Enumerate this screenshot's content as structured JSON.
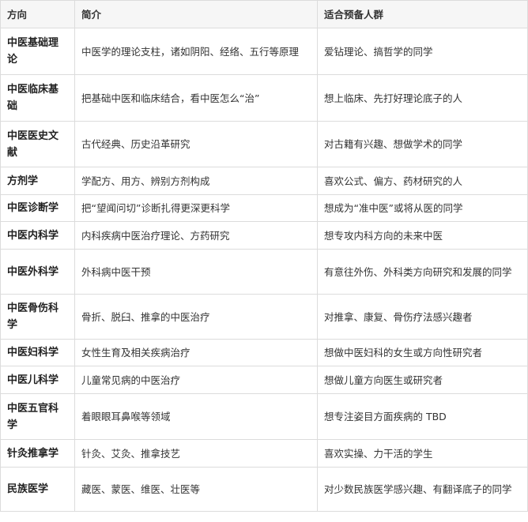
{
  "headers": [
    "方向",
    "简介",
    "适合预备人群"
  ],
  "rows": [
    {
      "dir": "中医基础理论",
      "intro": "中医学的理论支柱，诸如阴阳、经络、五行等原理",
      "audience": "爱钻理论、搞哲学的同学"
    },
    {
      "dir": "中医临床基础",
      "intro": "把基础中医和临床结合，看中医怎么“治”",
      "audience": "想上临床、先打好理论底子的人"
    },
    {
      "dir": "中医医史文献",
      "intro": "古代经典、历史沿革研究",
      "audience": "对古籍有兴趣、想做学术的同学"
    },
    {
      "dir": "方剂学",
      "intro": "学配方、用方、辨别方剂构成",
      "audience": "喜欢公式、偏方、药材研究的人"
    },
    {
      "dir": "中医诊断学",
      "intro": "把“望闻问切”诊断扎得更深更科学",
      "audience": "想成为“准中医”或将从医的同学"
    },
    {
      "dir": "中医内科学",
      "intro": "内科疾病中医治疗理论、方药研究",
      "audience": "想专攻内科方向的未来中医"
    },
    {
      "dir": "中医外科学",
      "intro": "外科病中医干预",
      "audience": "有意往外伤、外科类方向研究和发展的同学"
    },
    {
      "dir": "中医骨伤科学",
      "intro": "骨折、脱臼、推拿的中医治疗",
      "audience": "对推拿、康复、骨伤疗法感兴趣者"
    },
    {
      "dir": "中医妇科学",
      "intro": "女性生育及相关疾病治疗",
      "audience": "想做中医妇科的女生或方向性研究者"
    },
    {
      "dir": "中医儿科学",
      "intro": "儿童常见病的中医治疗",
      "audience": "想做儿童方向医生或研究者"
    },
    {
      "dir": "中医五官科学",
      "intro": "着眼眼耳鼻喉等领域",
      "audience": "想专注姿目方面疾病的 TBD"
    },
    {
      "dir": "针灸推拿学",
      "intro": "针灸、艾灸、推拿技艺",
      "audience": "喜欢实操、力干活的学生"
    },
    {
      "dir": "民族医学",
      "intro": "藏医、蒙医、维医、壮医等",
      "audience": "对少数民族医学感兴趣、有翻译底子的同学"
    }
  ]
}
